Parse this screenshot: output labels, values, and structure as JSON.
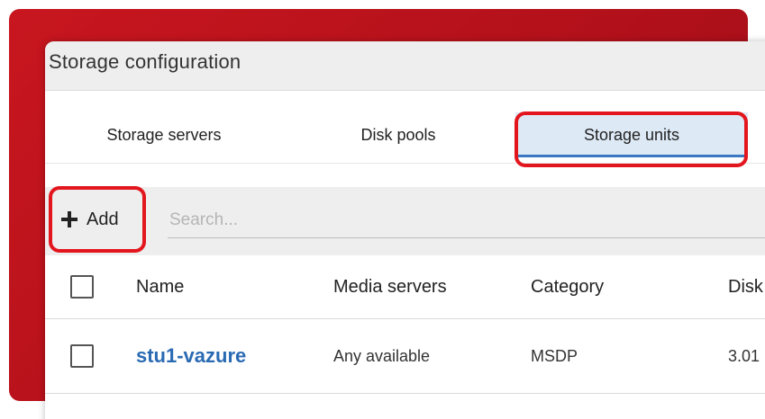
{
  "window": {
    "title": "Storage configuration"
  },
  "tabs": [
    {
      "label": "Storage servers",
      "selected": false
    },
    {
      "label": "Disk pools",
      "selected": false
    },
    {
      "label": "Storage units",
      "selected": true
    }
  ],
  "toolbar": {
    "add_label": "Add",
    "search_placeholder": "Search..."
  },
  "table": {
    "columns": [
      "Name",
      "Media servers",
      "Category",
      "Disk"
    ],
    "rows": [
      {
        "name": "stu1-vazure",
        "media_servers": "Any available",
        "category": "MSDP",
        "disk": "3.01"
      }
    ]
  },
  "colors": {
    "backdrop_red": "#c8161f",
    "highlight_red": "#e3161e",
    "link_blue": "#2a6ab3",
    "selected_tab_bg": "#dde9f5",
    "selected_tab_underline": "#3a78c2"
  },
  "icons": {
    "add": "plus-icon"
  }
}
